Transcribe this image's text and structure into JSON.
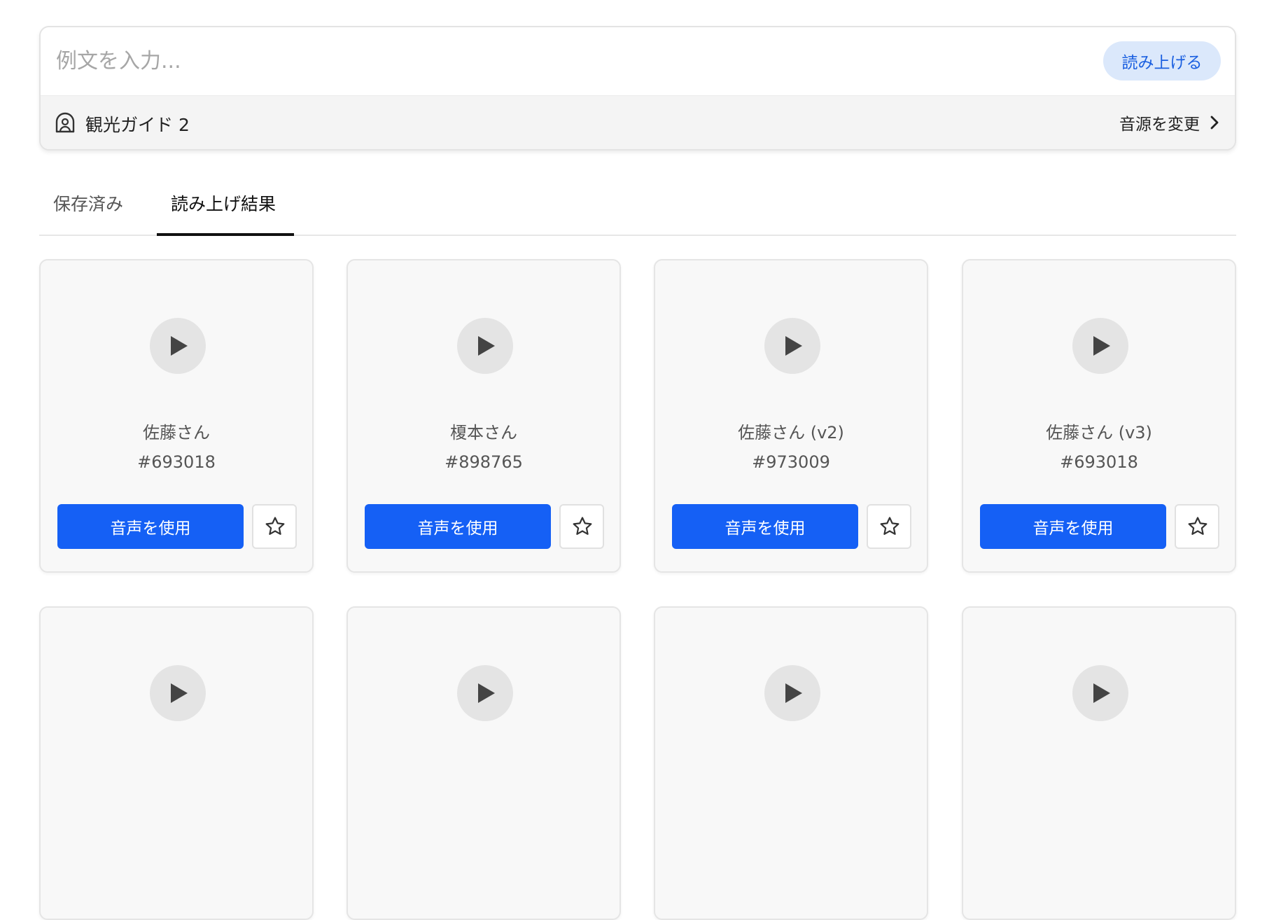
{
  "input": {
    "placeholder": "例文を入力...",
    "read_button": "読み上げる"
  },
  "voice_selector": {
    "icon": "voice-profile-icon",
    "name": "観光ガイド 2",
    "change_label": "音源を変更"
  },
  "tabs": [
    {
      "label": "保存済み",
      "active": false
    },
    {
      "label": "読み上げ結果",
      "active": true
    }
  ],
  "cards": [
    {
      "title": "佐藤さん",
      "id": "#693018",
      "use_label": "音声を使用"
    },
    {
      "title": "榎本さん",
      "id": "#898765",
      "use_label": "音声を使用"
    },
    {
      "title": "佐藤さん (v2)",
      "id": "#973009",
      "use_label": "音声を使用"
    },
    {
      "title": "佐藤さん (v3)",
      "id": "#693018",
      "use_label": "音声を使用"
    },
    {
      "title": "",
      "id": "",
      "use_label": ""
    },
    {
      "title": "",
      "id": "",
      "use_label": ""
    },
    {
      "title": "",
      "id": "",
      "use_label": ""
    },
    {
      "title": "",
      "id": "",
      "use_label": ""
    }
  ],
  "colors": {
    "primary": "#1560f5",
    "read_button_bg": "#dbe8fb",
    "read_button_text": "#1a5fe0",
    "card_bg": "#f8f8f8",
    "play_bg": "#e4e4e4"
  }
}
